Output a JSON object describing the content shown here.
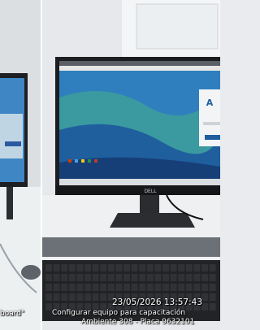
{
  "photo": {
    "description_none": "",
    "overlay": {
      "timestamp": "23/05/2026 13:57:43",
      "caption_line1": "Configurar equipo para capacitación",
      "caption_line2": "Ambiente 308 - Placa 9632101",
      "left_partial_text": "board\""
    },
    "monitor_brand": "DELL",
    "colors": {
      "wall": "#e7e9ec",
      "desk": "#eef0f1",
      "desk_front": "#6b7176",
      "screen_blue": "#2f7fbf",
      "screen_teal": "#3a9aa0",
      "monitor_frame": "#1c1d20",
      "keyboard": "#222326"
    }
  }
}
